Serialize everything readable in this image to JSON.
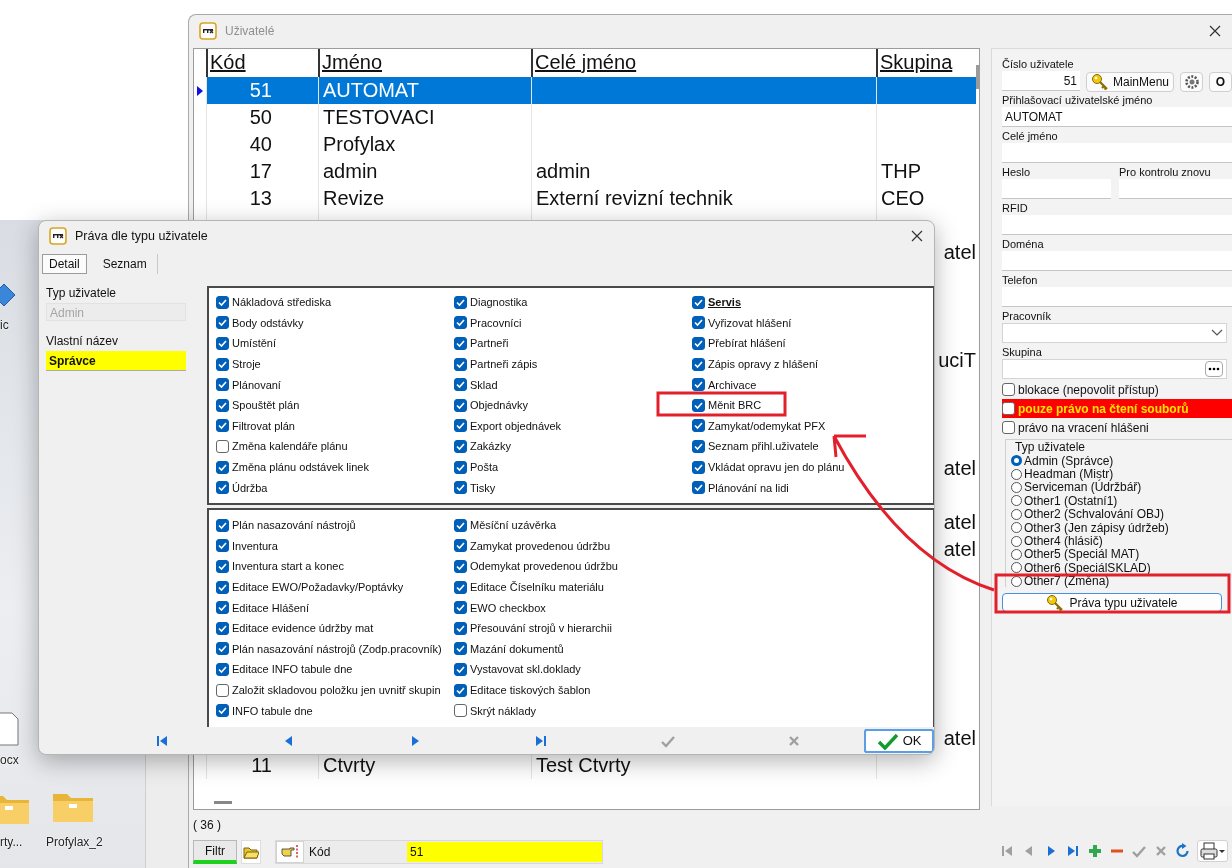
{
  "desktop": {
    "icons": [
      {
        "label": "ic",
        "kind": "shortcut"
      },
      {
        "label": "ocx",
        "kind": "file"
      },
      {
        "label": "rty...",
        "kind": "folder"
      },
      {
        "label": "Profylax_2",
        "kind": "folder"
      }
    ]
  },
  "main_window": {
    "title": "Uživatelé",
    "table": {
      "columns": [
        "Kód",
        "Jméno",
        "Celé jméno",
        "Skupina"
      ],
      "rows": [
        {
          "kind": "full",
          "selected": true,
          "code": "51",
          "name": "AUTOMAT"
        },
        {
          "kind": "full",
          "selected": false,
          "code": "50",
          "name": "TESTOVACI"
        },
        {
          "kind": "full",
          "selected": false,
          "code": "40",
          "name": "Profylax"
        },
        {
          "kind": "full",
          "selected": false,
          "code": "17",
          "name": "admin",
          "full_name": "admin",
          "group": "THP"
        },
        {
          "kind": "full",
          "selected": false,
          "code": "13",
          "name": "Revize",
          "full_name": "Externí revizní technik",
          "group": "CEO"
        },
        {
          "kind": "covered"
        },
        {
          "kind": "covered",
          "group": "atel"
        },
        {
          "kind": "covered"
        },
        {
          "kind": "covered"
        },
        {
          "kind": "covered"
        },
        {
          "kind": "covered",
          "group": "uciT"
        },
        {
          "kind": "covered"
        },
        {
          "kind": "covered"
        },
        {
          "kind": "covered"
        },
        {
          "kind": "covered",
          "group": "atel"
        },
        {
          "kind": "covered"
        },
        {
          "kind": "covered",
          "group": "atel"
        },
        {
          "kind": "covered",
          "group": "atel"
        },
        {
          "kind": "covered"
        },
        {
          "kind": "covered"
        },
        {
          "kind": "covered"
        },
        {
          "kind": "covered"
        },
        {
          "kind": "covered"
        },
        {
          "kind": "covered"
        },
        {
          "kind": "covered",
          "group": "atel"
        },
        {
          "kind": "full",
          "selected": false,
          "code": "11",
          "name": "Ctvrty",
          "full_name": "Test Ctvrty"
        }
      ]
    },
    "record_count": "( 36 )",
    "filter": {
      "button": "Filtr",
      "field_label": "Kód",
      "value": "51"
    },
    "toolbar": [
      {
        "kind": "first",
        "disabled": true
      },
      {
        "kind": "prev",
        "disabled": true
      },
      {
        "kind": "next",
        "disabled": false
      },
      {
        "kind": "last",
        "disabled": false
      },
      {
        "kind": "add",
        "disabled": false
      },
      {
        "kind": "delete",
        "disabled": false
      },
      {
        "kind": "confirm",
        "disabled": true
      },
      {
        "kind": "cancel",
        "disabled": true
      },
      {
        "kind": "refresh",
        "disabled": false
      },
      {
        "kind": "print",
        "disabled": false
      }
    ],
    "detail": {
      "user_number": {
        "label": "Číslo uživatele",
        "value": "51"
      },
      "main_menu_button": "MainMenu",
      "o_button": "O",
      "login": {
        "label": "Přihlašovací uživatelské jméno",
        "value": "AUTOMAT"
      },
      "full_name": {
        "label": "Celé jméno"
      },
      "password": {
        "label": "Heslo"
      },
      "password_confirm": {
        "label": "Pro kontrolu znovu"
      },
      "rfid": {
        "label": "RFID"
      },
      "domain": {
        "label": "Doména"
      },
      "phone": {
        "label": "Telefon"
      },
      "worker": {
        "label": "Pracovník"
      },
      "group": {
        "label": "Skupina"
      },
      "checkboxes": [
        {
          "label": "blokace (nepovolit přístup)",
          "checked": false,
          "kind": "plain"
        },
        {
          "label": "pouze právo na čtení souborů",
          "checked": false,
          "kind": "alert"
        },
        {
          "label": "právo na vracení hlášeni",
          "checked": false,
          "kind": "plain"
        }
      ],
      "user_type": {
        "label": "Typ uživatele",
        "options": [
          {
            "label": "Admin (Správce)",
            "selected": true
          },
          {
            "label": "Headman (Mistr)",
            "selected": false
          },
          {
            "label": "Serviceman (Údržbář)",
            "selected": false
          },
          {
            "label": "Other1 (Ostatní1)",
            "selected": false
          },
          {
            "label": "Other2 (Schvalování OBJ)",
            "selected": false
          },
          {
            "label": "Other3 (Jen zápisy údržeb)",
            "selected": false
          },
          {
            "label": "Other4 (hlásič)",
            "selected": false
          },
          {
            "label": "Other5 (Speciál MAT)",
            "selected": false
          },
          {
            "label": "Other6 (SpeciálSKLAD)",
            "selected": false
          },
          {
            "label": "Other7 (Změna)",
            "selected": false
          }
        ]
      },
      "rights_button": "Práva typu uživatele"
    }
  },
  "dialog": {
    "title": "Práva dle typu uživatele",
    "tabs": [
      {
        "label": "Detail",
        "selected": true
      },
      {
        "label": "Seznam",
        "selected": false
      }
    ],
    "user_type": {
      "label": "Typ uživatele",
      "value": "Admin",
      "disabled": true
    },
    "custom_name": {
      "label": "Vlastní název",
      "value": "Správce"
    },
    "groups": [
      {
        "columns": [
          {
            "items": [
              {
                "label": "Nákladová střediska",
                "checked": true
              },
              {
                "label": "Body odstávky",
                "checked": true
              },
              {
                "label": "Umístění",
                "checked": true
              },
              {
                "label": "Stroje",
                "checked": true
              },
              {
                "label": "Plánovaní",
                "checked": true
              },
              {
                "label": "Spouštět plán",
                "checked": true
              },
              {
                "label": "Filtrovat plán",
                "checked": true
              },
              {
                "label": "Změna kalendáře plánu",
                "checked": false
              },
              {
                "label": "Změna plánu odstávek linek",
                "checked": true
              },
              {
                "label": "Údržba",
                "checked": true
              }
            ]
          },
          {
            "items": [
              {
                "label": "Diagnostika",
                "checked": true
              },
              {
                "label": "Pracovníci",
                "checked": true
              },
              {
                "label": "Partneři",
                "checked": true
              },
              {
                "label": "Partneři zápis",
                "checked": true
              },
              {
                "label": "Sklad",
                "checked": true
              },
              {
                "label": "Objednávky",
                "checked": true
              },
              {
                "label": "Export objednávek",
                "checked": true
              },
              {
                "label": "Zakázky",
                "checked": true
              },
              {
                "label": "Pošta",
                "checked": true
              },
              {
                "label": "Tisky",
                "checked": true
              }
            ]
          },
          {
            "items": [
              {
                "label": "Servis",
                "checked": true,
                "heading": true
              },
              {
                "label": "Vyřizovat hlášení",
                "checked": true
              },
              {
                "label": "Přebírat hlášení",
                "checked": true
              },
              {
                "label": "Zápis opravy z hlášení",
                "checked": true
              },
              {
                "label": "Archivace",
                "checked": true
              },
              {
                "label": "Měnit BRC",
                "checked": true
              },
              {
                "label": "Zamykat/odemykat PFX",
                "checked": true
              },
              {
                "label": "Seznam přihl.uživatele",
                "checked": true
              },
              {
                "label": "Vkládat opravu jen do plánu",
                "checked": true
              },
              {
                "label": "Plánování na lidi",
                "checked": true
              }
            ]
          }
        ]
      },
      {
        "columns": [
          {
            "items": [
              {
                "label": "Plán nasazování nástrojů",
                "checked": true
              },
              {
                "label": "Inventura",
                "checked": true
              },
              {
                "label": "Inventura start a konec",
                "checked": true
              },
              {
                "label": "Editace EWO/Požadavky/Poptávky",
                "checked": true
              },
              {
                "label": "Editace Hlášení",
                "checked": true
              },
              {
                "label": "Editace evidence údržby mat",
                "checked": true
              },
              {
                "label": "Plán nasazování nástrojů (Zodp.pracovník)",
                "checked": true
              },
              {
                "label": "Editace INFO tabule dne",
                "checked": true
              },
              {
                "label": "Založit skladovou položku jen uvnitř skupin",
                "checked": false
              },
              {
                "label": "INFO tabule dne",
                "checked": true
              }
            ]
          },
          {
            "items": [
              {
                "label": "Měsíční uzávěrka",
                "checked": true
              },
              {
                "label": "Zamykat provedenou údržbu",
                "checked": true
              },
              {
                "label": "Odemykat provedenou údržbu",
                "checked": true
              },
              {
                "label": "Editace Číselníku materiálu",
                "checked": true
              },
              {
                "label": "EWO checkbox",
                "checked": true
              },
              {
                "label": "Přesouvání strojů v hierarchii",
                "checked": true
              },
              {
                "label": "Mazání dokumentů",
                "checked": true
              },
              {
                "label": "Vystavovat skl.doklady",
                "checked": true
              },
              {
                "label": "Editace tiskových šablon",
                "checked": true
              },
              {
                "label": "Skrýt náklady",
                "checked": false
              }
            ]
          }
        ]
      }
    ],
    "navigator": [
      {
        "kind": "first",
        "disabled": false
      },
      {
        "kind": "prev",
        "disabled": false
      },
      {
        "kind": "next",
        "disabled": false
      },
      {
        "kind": "last",
        "disabled": false
      },
      {
        "kind": "confirm",
        "disabled": true
      },
      {
        "kind": "cancel",
        "disabled": true
      }
    ],
    "ok_button": "OK"
  },
  "annotations": [
    {
      "kind": "frame"
    },
    {
      "kind": "frame"
    },
    {
      "kind": "arrow"
    }
  ]
}
